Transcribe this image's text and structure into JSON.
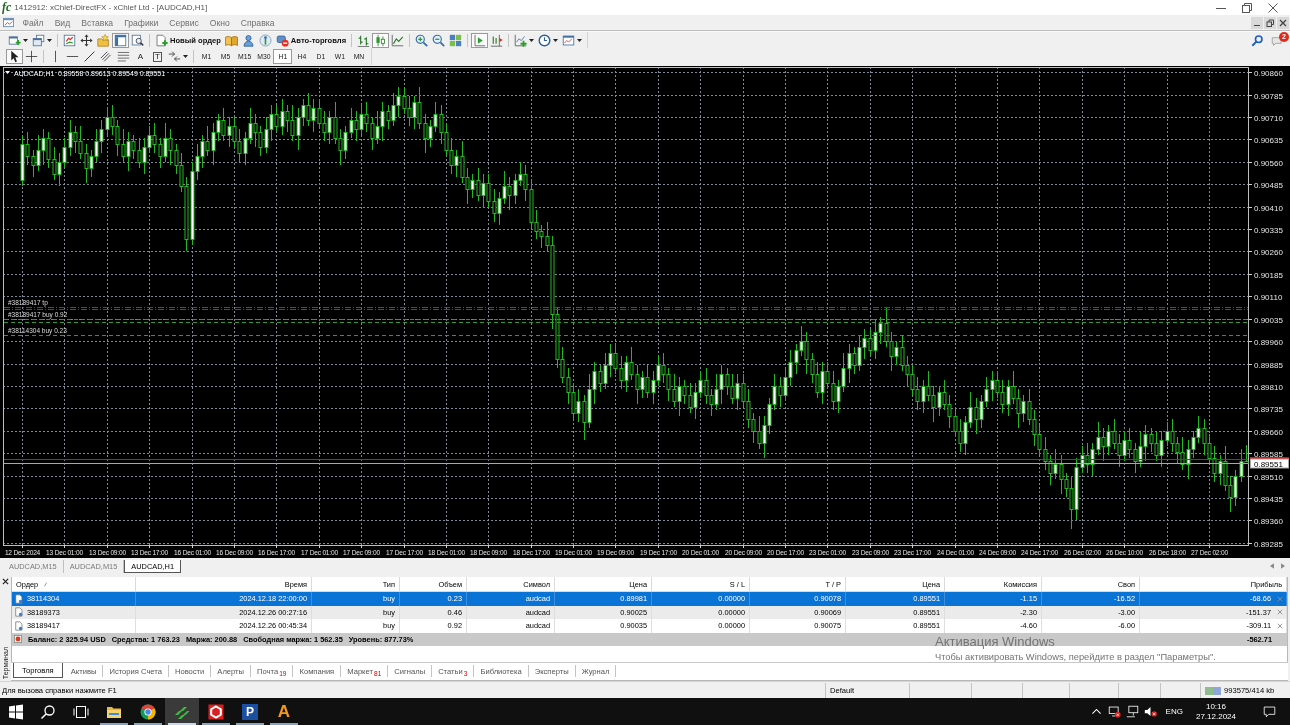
{
  "window": {
    "logo": "fc",
    "title": "1412912: xChief-DirectFX - xChief Ltd - [AUDCAD,H1]"
  },
  "menu": [
    "Файл",
    "Вид",
    "Вставка",
    "Графики",
    "Сервис",
    "Окно",
    "Справка"
  ],
  "toolbar_1": {
    "groups": [
      [
        {
          "kind": "new-chart",
          "pressed": false
        },
        {
          "kind": "profiles",
          "pressed": false
        }
      ],
      [
        {
          "kind": "market-watch",
          "pressed": false
        },
        {
          "kind": "data-window",
          "pressed": false
        },
        {
          "kind": "navigator",
          "pressed": false
        },
        {
          "kind": "terminal",
          "pressed": true
        },
        {
          "kind": "strategy-tester",
          "pressed": false
        }
      ],
      [
        {
          "kind": "new-order",
          "label": "Новый ордер",
          "pressed": false
        },
        {
          "kind": "metaeditor",
          "pressed": false
        },
        {
          "kind": "account",
          "pressed": false
        },
        {
          "kind": "signals",
          "pressed": false
        },
        {
          "kind": "auto-trading",
          "label": "Авто-торговля",
          "pressed": false
        }
      ],
      [
        {
          "kind": "bar-chart",
          "pressed": false
        },
        {
          "kind": "candlesticks",
          "pressed": true
        },
        {
          "kind": "line-chart",
          "pressed": false
        }
      ],
      [
        {
          "kind": "zoom-in",
          "pressed": false
        },
        {
          "kind": "zoom-out",
          "pressed": false
        },
        {
          "kind": "tile",
          "pressed": false
        }
      ],
      [
        {
          "kind": "auto-scroll",
          "pressed": true
        },
        {
          "kind": "chart-shift",
          "pressed": false
        }
      ],
      [
        {
          "kind": "indicators",
          "pressed": false
        },
        {
          "kind": "periods",
          "pressed": false
        },
        {
          "kind": "templates",
          "pressed": false
        }
      ]
    ],
    "messages_badge": "2"
  },
  "toolbar_2": {
    "groups": [
      [
        {
          "kind": "cursor",
          "pressed": true
        },
        {
          "kind": "crosshair",
          "pressed": false
        }
      ],
      [
        {
          "kind": "vertical-line",
          "pressed": false
        },
        {
          "kind": "horizontal-line",
          "pressed": false
        },
        {
          "kind": "trendline",
          "pressed": false
        },
        {
          "kind": "channel",
          "pressed": false
        },
        {
          "kind": "fibonacci",
          "pressed": false
        },
        {
          "kind": "text",
          "glyph": "A",
          "pressed": false
        },
        {
          "kind": "label",
          "glyph": "T",
          "pressed": false
        },
        {
          "kind": "arrows",
          "pressed": false
        }
      ]
    ],
    "timeframes": [
      {
        "label": "M1",
        "selected": false
      },
      {
        "label": "M5",
        "selected": false
      },
      {
        "label": "M15",
        "selected": false
      },
      {
        "label": "M30",
        "selected": false
      },
      {
        "label": "H1",
        "selected": true
      },
      {
        "label": "H4",
        "selected": false
      },
      {
        "label": "D1",
        "selected": false
      },
      {
        "label": "W1",
        "selected": false
      },
      {
        "label": "MN",
        "selected": false
      }
    ]
  },
  "chart": {
    "header": {
      "symbol": "AUDCAD,H1",
      "quote": "0.89558 0.89613 0.89549 0.89551"
    },
    "chart_data": {
      "type": "candlestick",
      "ylim": [
        0.89278,
        0.90877
      ],
      "yticks": [
        {
          "value": 0.9086,
          "label": "0.90860"
        },
        0.90785,
        {
          "value": 0.9071,
          "label": "0.90710"
        },
        0.90635,
        {
          "value": 0.9056,
          "label": "0.90560"
        },
        0.90485,
        {
          "value": 0.9041,
          "label": "0.90410"
        },
        0.90335,
        {
          "value": 0.9026,
          "label": "0.90260"
        },
        0.90185,
        {
          "value": 0.9011,
          "label": "0.90110"
        },
        0.90035,
        {
          "value": 0.8996,
          "label": "0.89960"
        },
        0.89885,
        {
          "value": 0.8981,
          "label": "0.89810"
        },
        0.89735,
        {
          "value": 0.8966,
          "label": "0.89660"
        },
        0.89585,
        {
          "value": 0.8951,
          "label": "0.89510"
        },
        0.89435,
        {
          "value": 0.8936,
          "label": "0.89360"
        },
        0.89285
      ],
      "grid": true,
      "categories": [
        "12 Dec 2024",
        null,
        null,
        null,
        null,
        null,
        null,
        null,
        "13 Dec 01:00",
        null,
        null,
        null,
        null,
        null,
        null,
        null,
        "13 Dec 09:00",
        null,
        null,
        null,
        null,
        null,
        null,
        null,
        "13 Dec 17:00",
        null,
        null,
        null,
        null,
        null,
        null,
        null,
        "16 Dec 01:00",
        null,
        null,
        null,
        null,
        null,
        null,
        null,
        "16 Dec 09:00",
        null,
        null,
        null,
        null,
        null,
        null,
        null,
        "16 Dec 17:00",
        null,
        null,
        null,
        null,
        null,
        null,
        null,
        "17 Dec 01:00",
        null,
        null,
        null,
        null,
        null,
        null,
        null,
        "17 Dec 09:00",
        null,
        null,
        null,
        null,
        null,
        null,
        null,
        "17 Dec 17:00",
        null,
        null,
        null,
        null,
        null,
        null,
        null,
        "18 Dec 01:00",
        null,
        null,
        null,
        null,
        null,
        null,
        null,
        "18 Dec 09:00",
        null,
        null,
        null,
        null,
        null,
        null,
        null,
        "18 Dec 17:00",
        null,
        null,
        null,
        null,
        null,
        null,
        null,
        "19 Dec 01:00",
        null,
        null,
        null,
        null,
        null,
        null,
        null,
        "19 Dec 09:00",
        null,
        null,
        null,
        null,
        null,
        null,
        null,
        "19 Dec 17:00",
        null,
        null,
        null,
        null,
        null,
        null,
        null,
        "20 Dec 01:00",
        null,
        null,
        null,
        null,
        null,
        null,
        null,
        "20 Dec 09:00",
        null,
        null,
        null,
        null,
        null,
        null,
        null,
        "20 Dec 17:00",
        null,
        null,
        null,
        null,
        null,
        null,
        null,
        "23 Dec 01:00",
        null,
        null,
        null,
        null,
        null,
        null,
        null,
        "23 Dec 09:00",
        null,
        null,
        null,
        null,
        null,
        null,
        null,
        "23 Dec 17:00",
        null,
        null,
        null,
        null,
        null,
        null,
        null,
        "24 Dec 01:00",
        null,
        null,
        null,
        null,
        null,
        null,
        null,
        "24 Dec 09:00",
        null,
        null,
        null,
        null,
        null,
        null,
        null,
        "24 Dec 17:00",
        null,
        null,
        null,
        null,
        null,
        null,
        null,
        "26 Dec 02:00",
        null,
        null,
        null,
        null,
        null,
        null,
        null,
        "26 Dec 10:00",
        null,
        null,
        null,
        null,
        null,
        null,
        null,
        "26 Dec 18:00",
        null,
        null,
        null,
        null,
        null,
        null,
        null,
        "27 Dec 02:00",
        null,
        null,
        null,
        null,
        null,
        null,
        null
      ],
      "ohlc": [
        [
          0.905,
          0.9065,
          0.9048,
          0.9062
        ],
        [
          0.9062,
          0.9066,
          0.9055,
          0.9058
        ],
        [
          0.9058,
          0.906,
          0.9051,
          0.9055
        ],
        [
          0.9055,
          0.9065,
          0.9053,
          0.906
        ],
        [
          0.906,
          0.9067,
          0.9055,
          0.9064
        ],
        [
          0.9064,
          0.9066,
          0.9054,
          0.9057
        ],
        [
          0.9057,
          0.9061,
          0.905,
          0.9052
        ],
        [
          0.9052,
          0.9059,
          0.9048,
          0.9056
        ],
        [
          0.9056,
          0.9064,
          0.9054,
          0.9061
        ],
        [
          0.9061,
          0.907,
          0.9058,
          0.9066
        ],
        [
          0.9066,
          0.9068,
          0.9059,
          0.9063
        ],
        [
          0.9063,
          0.9068,
          0.9057,
          0.9059
        ],
        [
          0.9059,
          0.9062,
          0.9049,
          0.9054
        ],
        [
          0.9054,
          0.906,
          0.9051,
          0.9058
        ],
        [
          0.9058,
          0.9067,
          0.9056,
          0.9063
        ],
        [
          0.9063,
          0.907,
          0.9059,
          0.9067
        ],
        [
          0.9067,
          0.9074,
          0.9065,
          0.9071
        ],
        [
          0.9071,
          0.9075,
          0.9065,
          0.9068
        ],
        [
          0.9068,
          0.907,
          0.9058,
          0.9062
        ],
        [
          0.9062,
          0.9067,
          0.9056,
          0.9058
        ],
        [
          0.9058,
          0.9066,
          0.9053,
          0.9063
        ],
        [
          0.9063,
          0.9065,
          0.9057,
          0.906
        ],
        [
          0.906,
          0.9064,
          0.9054,
          0.9056
        ],
        [
          0.9056,
          0.9064,
          0.9052,
          0.9061
        ],
        [
          0.9061,
          0.9068,
          0.9059,
          0.9065
        ],
        [
          0.9065,
          0.9069,
          0.9059,
          0.9062
        ],
        [
          0.9062,
          0.9064,
          0.9054,
          0.9058
        ],
        [
          0.9058,
          0.9069,
          0.9056,
          0.9064
        ],
        [
          0.9064,
          0.9067,
          0.9055,
          0.906
        ],
        [
          0.906,
          0.9062,
          0.9052,
          0.9055
        ],
        [
          0.9055,
          0.9059,
          0.9046,
          0.9048
        ],
        [
          0.9048,
          0.9051,
          0.9026,
          0.903
        ],
        [
          0.903,
          0.9056,
          0.9028,
          0.9053
        ],
        [
          0.9053,
          0.9062,
          0.905,
          0.9058
        ],
        [
          0.9058,
          0.9065,
          0.9054,
          0.9063
        ],
        [
          0.9063,
          0.9068,
          0.9058,
          0.906
        ],
        [
          0.906,
          0.9069,
          0.9055,
          0.9066
        ],
        [
          0.9066,
          0.9072,
          0.9063,
          0.907
        ],
        [
          0.907,
          0.9074,
          0.9063,
          0.9065
        ],
        [
          0.9065,
          0.9071,
          0.9061,
          0.9068
        ],
        [
          0.9068,
          0.9071,
          0.9061,
          0.9063
        ],
        [
          0.9063,
          0.9067,
          0.9056,
          0.9059
        ],
        [
          0.9059,
          0.9066,
          0.9055,
          0.9064
        ],
        [
          0.9064,
          0.9074,
          0.9062,
          0.9069
        ],
        [
          0.9069,
          0.9072,
          0.9061,
          0.9066
        ],
        [
          0.9066,
          0.9068,
          0.9058,
          0.9061
        ],
        [
          0.9061,
          0.9071,
          0.9059,
          0.9067
        ],
        [
          0.9067,
          0.9075,
          0.9063,
          0.9072
        ],
        [
          0.9072,
          0.9075,
          0.9066,
          0.9068
        ],
        [
          0.9068,
          0.9077,
          0.9065,
          0.9073
        ],
        [
          0.9073,
          0.9075,
          0.9066,
          0.907
        ],
        [
          0.907,
          0.9075,
          0.9063,
          0.9065
        ],
        [
          0.9065,
          0.9074,
          0.906,
          0.9071
        ],
        [
          0.9071,
          0.9077,
          0.9068,
          0.9075
        ],
        [
          0.9075,
          0.9079,
          0.9068,
          0.907
        ],
        [
          0.907,
          0.9077,
          0.9066,
          0.9074
        ],
        [
          0.9074,
          0.9077,
          0.9067,
          0.9069
        ],
        [
          0.9069,
          0.9073,
          0.9063,
          0.9066
        ],
        [
          0.9066,
          0.9073,
          0.9062,
          0.9071
        ],
        [
          0.9071,
          0.9076,
          0.9062,
          0.9064
        ],
        [
          0.9064,
          0.9067,
          0.9055,
          0.906
        ],
        [
          0.906,
          0.9068,
          0.9057,
          0.9066
        ],
        [
          0.9066,
          0.9074,
          0.9064,
          0.907
        ],
        [
          0.907,
          0.9073,
          0.9063,
          0.9067
        ],
        [
          0.9067,
          0.9075,
          0.9065,
          0.9072
        ],
        [
          0.9072,
          0.9076,
          0.9066,
          0.9069
        ],
        [
          0.9069,
          0.9071,
          0.906,
          0.9064
        ],
        [
          0.9064,
          0.9073,
          0.9062,
          0.9068
        ],
        [
          0.9068,
          0.9076,
          0.9063,
          0.9073
        ],
        [
          0.9073,
          0.9075,
          0.9067,
          0.907
        ],
        [
          0.907,
          0.9079,
          0.9068,
          0.9075
        ],
        [
          0.9075,
          0.9081,
          0.9071,
          0.9078
        ],
        [
          0.9078,
          0.9081,
          0.9072,
          0.9074
        ],
        [
          0.9074,
          0.9078,
          0.9068,
          0.9071
        ],
        [
          0.9071,
          0.9078,
          0.9067,
          0.9076
        ],
        [
          0.9076,
          0.9081,
          0.9067,
          0.9069
        ],
        [
          0.9069,
          0.9072,
          0.9059,
          0.9064
        ],
        [
          0.9064,
          0.907,
          0.9061,
          0.9068
        ],
        [
          0.9068,
          0.9076,
          0.9066,
          0.9072
        ],
        [
          0.9072,
          0.9075,
          0.9062,
          0.9066
        ],
        [
          0.9066,
          0.9069,
          0.9058,
          0.906
        ],
        [
          0.906,
          0.9064,
          0.9052,
          0.9055
        ],
        [
          0.9055,
          0.906,
          0.9051,
          0.9058
        ],
        [
          0.9058,
          0.9063,
          0.9049,
          0.9051
        ],
        [
          0.9051,
          0.9054,
          0.9042,
          0.9047
        ],
        [
          0.9047,
          0.9052,
          0.9044,
          0.905
        ],
        [
          0.905,
          0.9054,
          0.9043,
          0.9045
        ],
        [
          0.9045,
          0.9052,
          0.9041,
          0.9049
        ],
        [
          0.9049,
          0.9052,
          0.9041,
          0.9043
        ],
        [
          0.9043,
          0.9047,
          0.9036,
          0.9039
        ],
        [
          0.9039,
          0.9046,
          0.9035,
          0.9044
        ],
        [
          0.9044,
          0.9053,
          0.9042,
          0.9048
        ],
        [
          0.9048,
          0.9051,
          0.904,
          0.9045
        ],
        [
          0.9045,
          0.9052,
          0.9042,
          0.905
        ],
        [
          0.905,
          0.9056,
          0.9048,
          0.9052
        ],
        [
          0.9052,
          0.9055,
          0.9043,
          0.9047
        ],
        [
          0.9047,
          0.905,
          0.9034,
          0.9036
        ],
        [
          0.9036,
          0.904,
          0.903,
          0.9033
        ],
        [
          0.9033,
          0.9035,
          0.9027,
          0.9031
        ],
        [
          0.9031,
          0.9036,
          0.9026,
          0.9028
        ],
        [
          0.9028,
          0.9031,
          0.9,
          0.9005
        ],
        [
          0.9005,
          0.9007,
          0.8987,
          0.899
        ],
        [
          0.899,
          0.8994,
          0.8982,
          0.8984
        ],
        [
          0.8984,
          0.8987,
          0.8975,
          0.8979
        ],
        [
          0.8979,
          0.8982,
          0.897,
          0.8972
        ],
        [
          0.8972,
          0.898,
          0.8969,
          0.8976
        ],
        [
          0.8976,
          0.8978,
          0.8963,
          0.8969
        ],
        [
          0.8969,
          0.8985,
          0.8967,
          0.898
        ],
        [
          0.898,
          0.8989,
          0.8975,
          0.8986
        ],
        [
          0.8986,
          0.8988,
          0.8979,
          0.8982
        ],
        [
          0.8982,
          0.8992,
          0.898,
          0.8988
        ],
        [
          0.8988,
          0.8995,
          0.8984,
          0.8992
        ],
        [
          0.8992,
          0.8995,
          0.8985,
          0.8987
        ],
        [
          0.8987,
          0.8991,
          0.898,
          0.8983
        ],
        [
          0.8983,
          0.8991,
          0.8979,
          0.8989
        ],
        [
          0.8989,
          0.8994,
          0.8983,
          0.8985
        ],
        [
          0.8985,
          0.8988,
          0.8975,
          0.898
        ],
        [
          0.898,
          0.8986,
          0.8977,
          0.8984
        ],
        [
          0.8984,
          0.8988,
          0.8977,
          0.8979
        ],
        [
          0.8979,
          0.8986,
          0.8975,
          0.8983
        ],
        [
          0.8983,
          0.8991,
          0.8981,
          0.8988
        ],
        [
          0.8988,
          0.8992,
          0.8982,
          0.8985
        ],
        [
          0.8985,
          0.8987,
          0.8976,
          0.898
        ],
        [
          0.898,
          0.8985,
          0.8974,
          0.8976
        ],
        [
          0.8976,
          0.8984,
          0.8971,
          0.8981
        ],
        [
          0.8981,
          0.8983,
          0.8975,
          0.8978
        ],
        [
          0.8978,
          0.8982,
          0.8972,
          0.8974
        ],
        [
          0.8974,
          0.8982,
          0.897,
          0.8979
        ],
        [
          0.8979,
          0.8986,
          0.8977,
          0.8983
        ],
        [
          0.8983,
          0.8987,
          0.8975,
          0.8978
        ],
        [
          0.8978,
          0.898,
          0.8971,
          0.8975
        ],
        [
          0.8975,
          0.8985,
          0.8973,
          0.898
        ],
        [
          0.898,
          0.8988,
          0.8975,
          0.8985
        ],
        [
          0.8985,
          0.8987,
          0.8978,
          0.8981
        ],
        [
          0.8981,
          0.8985,
          0.8975,
          0.8977
        ],
        [
          0.8977,
          0.8985,
          0.8973,
          0.8982
        ],
        [
          0.8982,
          0.8985,
          0.8974,
          0.8976
        ],
        [
          0.8976,
          0.898,
          0.8967,
          0.897
        ],
        [
          0.897,
          0.8972,
          0.8962,
          0.8966
        ],
        [
          0.8966,
          0.8971,
          0.896,
          0.8962
        ],
        [
          0.8962,
          0.8971,
          0.8957,
          0.8968
        ],
        [
          0.8968,
          0.8977,
          0.8965,
          0.8975
        ],
        [
          0.8975,
          0.8985,
          0.8973,
          0.8981
        ],
        [
          0.8981,
          0.8984,
          0.8974,
          0.8978
        ],
        [
          0.8978,
          0.8987,
          0.8976,
          0.8984
        ],
        [
          0.8984,
          0.8993,
          0.8981,
          0.8989
        ],
        [
          0.8989,
          0.8995,
          0.8985,
          0.8993
        ],
        [
          0.8993,
          0.9001,
          0.8991,
          0.8996
        ],
        [
          0.8996,
          0.8999,
          0.8985,
          0.899
        ],
        [
          0.899,
          0.8992,
          0.8982,
          0.8985
        ],
        [
          0.8985,
          0.8989,
          0.8977,
          0.8979
        ],
        [
          0.8979,
          0.8989,
          0.8975,
          0.8986
        ],
        [
          0.8986,
          0.8989,
          0.898,
          0.8982
        ],
        [
          0.8982,
          0.8986,
          0.8973,
          0.8976
        ],
        [
          0.8976,
          0.8983,
          0.8972,
          0.8981
        ],
        [
          0.8981,
          0.8992,
          0.8979,
          0.8987
        ],
        [
          0.8987,
          0.8995,
          0.8982,
          0.8992
        ],
        [
          0.8992,
          0.8994,
          0.8985,
          0.8988
        ],
        [
          0.8988,
          0.8998,
          0.8986,
          0.8994
        ],
        [
          0.8994,
          0.9,
          0.899,
          0.8997
        ],
        [
          0.8997,
          0.9,
          0.8991,
          0.8993
        ],
        [
          0.8993,
          0.9003,
          0.899,
          0.8999
        ],
        [
          0.8999,
          0.9004,
          0.8995,
          0.9002
        ],
        [
          0.9002,
          0.9007,
          0.8994,
          0.8996
        ],
        [
          0.8996,
          0.8999,
          0.8986,
          0.8991
        ],
        [
          0.8991,
          0.8996,
          0.8988,
          0.8994
        ],
        [
          0.8994,
          0.8998,
          0.8986,
          0.8988
        ],
        [
          0.8988,
          0.8991,
          0.8981,
          0.8985
        ],
        [
          0.8985,
          0.8988,
          0.8978,
          0.898
        ],
        [
          0.898,
          0.8984,
          0.8973,
          0.8976
        ],
        [
          0.8976,
          0.8983,
          0.8972,
          0.8981
        ],
        [
          0.8981,
          0.8986,
          0.8976,
          0.8978
        ],
        [
          0.8978,
          0.8981,
          0.8969,
          0.8974
        ],
        [
          0.8974,
          0.8981,
          0.8971,
          0.8979
        ],
        [
          0.8979,
          0.8983,
          0.8973,
          0.8975
        ],
        [
          0.8975,
          0.8978,
          0.8967,
          0.8971
        ],
        [
          0.8971,
          0.8974,
          0.8964,
          0.8966
        ],
        [
          0.8966,
          0.897,
          0.8959,
          0.8962
        ],
        [
          0.8962,
          0.8971,
          0.8958,
          0.8969
        ],
        [
          0.8969,
          0.8979,
          0.8967,
          0.8974
        ],
        [
          0.8974,
          0.8977,
          0.8965,
          0.897
        ],
        [
          0.897,
          0.8978,
          0.8967,
          0.8976
        ],
        [
          0.8976,
          0.8984,
          0.8974,
          0.898
        ],
        [
          0.898,
          0.8986,
          0.8976,
          0.8983
        ],
        [
          0.8983,
          0.8986,
          0.8977,
          0.8979
        ],
        [
          0.8979,
          0.8983,
          0.8972,
          0.8975
        ],
        [
          0.8975,
          0.8983,
          0.8971,
          0.8981
        ],
        [
          0.8981,
          0.8986,
          0.8975,
          0.8977
        ],
        [
          0.8977,
          0.898,
          0.8967,
          0.8972
        ],
        [
          0.8972,
          0.8978,
          0.8969,
          0.8976
        ],
        [
          0.8976,
          0.898,
          0.8968,
          0.897
        ],
        [
          0.897,
          0.8973,
          0.8961,
          0.8965
        ],
        [
          0.8965,
          0.8968,
          0.8958,
          0.896
        ],
        [
          0.896,
          0.8964,
          0.8953,
          0.8956
        ],
        [
          0.8956,
          0.8958,
          0.8948,
          0.8952
        ],
        [
          0.8952,
          0.896,
          0.895,
          0.8955
        ],
        [
          0.8955,
          0.8958,
          0.8945,
          0.895
        ],
        [
          0.895,
          0.8952,
          0.8944,
          0.8947
        ],
        [
          0.8947,
          0.8951,
          0.8933,
          0.894
        ],
        [
          0.894,
          0.8957,
          0.8936,
          0.8954
        ],
        [
          0.8954,
          0.8961,
          0.8952,
          0.8958
        ],
        [
          0.8958,
          0.8962,
          0.8952,
          0.8955
        ],
        [
          0.8955,
          0.8962,
          0.8951,
          0.896
        ],
        [
          0.896,
          0.8969,
          0.8958,
          0.8964
        ],
        [
          0.8964,
          0.8967,
          0.8956,
          0.8961
        ],
        [
          0.8961,
          0.8968,
          0.8958,
          0.8966
        ],
        [
          0.8966,
          0.897,
          0.896,
          0.8962
        ],
        [
          0.8962,
          0.8965,
          0.8954,
          0.8958
        ],
        [
          0.8958,
          0.8966,
          0.8956,
          0.8963
        ],
        [
          0.8963,
          0.8967,
          0.8957,
          0.896
        ],
        [
          0.896,
          0.8962,
          0.8952,
          0.8956
        ],
        [
          0.8956,
          0.8966,
          0.8954,
          0.8961
        ],
        [
          0.8961,
          0.8968,
          0.8956,
          0.8965
        ],
        [
          0.8965,
          0.8967,
          0.8959,
          0.8962
        ],
        [
          0.8962,
          0.8966,
          0.8956,
          0.8958
        ],
        [
          0.8958,
          0.8966,
          0.8954,
          0.8963
        ],
        [
          0.8963,
          0.8969,
          0.8961,
          0.8966
        ],
        [
          0.8966,
          0.897,
          0.8959,
          0.8962
        ],
        [
          0.8962,
          0.8964,
          0.8955,
          0.8959
        ],
        [
          0.8959,
          0.8964,
          0.8953,
          0.8955
        ],
        [
          0.8955,
          0.8963,
          0.895,
          0.896
        ],
        [
          0.896,
          0.8966,
          0.8957,
          0.8964
        ],
        [
          0.8964,
          0.8971,
          0.8962,
          0.8967
        ],
        [
          0.8967,
          0.897,
          0.8958,
          0.8962
        ],
        [
          0.8962,
          0.8965,
          0.8955,
          0.8957
        ],
        [
          0.8957,
          0.8961,
          0.8949,
          0.8952
        ],
        [
          0.8952,
          0.8958,
          0.8948,
          0.8956
        ],
        [
          0.8956,
          0.8961,
          0.8946,
          0.8948
        ],
        [
          0.8948,
          0.8951,
          0.8939,
          0.8944
        ],
        [
          0.8944,
          0.8953,
          0.8941,
          0.8951
        ],
        [
          0.8951,
          0.896,
          0.8949,
          0.8956
        ],
        [
          0.89558,
          0.89613,
          0.89549,
          0.89551
        ]
      ],
      "ref_lines": [
        {
          "axis": "y",
          "value": 0.90075,
          "label": "#38189417 tp",
          "color": "#ff0000",
          "line_style": "dashdot"
        },
        {
          "axis": "y",
          "value": 0.90069,
          "color": "#ff0000",
          "line_style": "dashdot"
        },
        {
          "axis": "y",
          "value": 0.90035,
          "label": "#38189417 buy 0.92",
          "color": "#2f9a2f",
          "line_style": "dashed"
        },
        {
          "axis": "y",
          "value": 0.90025,
          "color": "#2f9a2f",
          "line_style": "dashed"
        },
        {
          "axis": "y",
          "value": 0.89981,
          "label": "#38114304 buy 0.23",
          "color": "#2f9a2f",
          "line_style": "dashed"
        },
        {
          "axis": "y",
          "value": 0.89567,
          "color": "#ff0000",
          "line_style": "solid"
        },
        {
          "axis": "y",
          "value": 0.89551,
          "label": "0.89551",
          "color": "#a8a8a8",
          "line_style": "solid"
        }
      ]
    }
  },
  "chart_tabs": [
    {
      "label": "AUDCAD,M15",
      "selected": false
    },
    {
      "label": "AUDCAD,M15",
      "selected": false
    },
    {
      "label": "AUDCAD,H1",
      "selected": true
    }
  ],
  "terminal": {
    "title": "Терминал",
    "columns": [
      {
        "label": "Ордер",
        "sorted": true
      },
      {
        "label": "Время",
        "sorted": false
      },
      {
        "label": "Тип",
        "sorted": false
      },
      {
        "label": "Объем",
        "sorted": false
      },
      {
        "label": "Символ",
        "sorted": false
      },
      {
        "label": "Цена",
        "sorted": false
      },
      {
        "label": "S / L",
        "sorted": false
      },
      {
        "label": "T / P",
        "sorted": false
      },
      {
        "label": "Цена",
        "sorted": false
      },
      {
        "label": "Комиссия",
        "sorted": false
      },
      {
        "label": "Своп",
        "sorted": false
      },
      {
        "label": "Прибыль",
        "sorted": false
      }
    ],
    "rows": [
      {
        "cells": [
          "38114304",
          "2024.12.18 22:00:00",
          "buy",
          "0.23",
          "audcad",
          "0.89981",
          "0.00000",
          "0.90078",
          "0.89551",
          "-1.15",
          "-16.52",
          "-68.66"
        ],
        "selected": true
      },
      {
        "cells": [
          "38189373",
          "2024.12.26 00:27:16",
          "buy",
          "0.46",
          "audcad",
          "0.90025",
          "0.00000",
          "0.90069",
          "0.89551",
          "-2.30",
          "-3.00",
          "-151.37"
        ],
        "selected": false
      },
      {
        "cells": [
          "38189417",
          "2024.12.26 00:45:34",
          "buy",
          "0.92",
          "audcad",
          "0.90035",
          "0.00000",
          "0.90075",
          "0.89551",
          "-4.60",
          "-6.00",
          "-309.11"
        ],
        "selected": false
      }
    ],
    "summary": {
      "fields": [
        "Баланс: 2 325.94 USD",
        "Средства: 1 763.23",
        "Маржа: 200.88",
        "Свободная маржа: 1 562.35",
        "Уровень: 877.73%"
      ],
      "total": "-562.71"
    },
    "tabs": [
      {
        "label": "Торговля",
        "selected": true
      },
      {
        "label": "Активы",
        "selected": false
      },
      {
        "label": "История Счета",
        "selected": false
      },
      {
        "label": "Новости",
        "selected": false
      },
      {
        "label": "Алерты",
        "selected": false
      },
      {
        "label": "Почта",
        "badge": "19",
        "selected": false
      },
      {
        "label": "Компания",
        "selected": false
      },
      {
        "label": "Маркет",
        "badge": "81",
        "selected": false
      },
      {
        "label": "Сигналы",
        "selected": false
      },
      {
        "label": "Статьи",
        "badge": "3",
        "selected": false
      },
      {
        "label": "Библиотека",
        "selected": false
      },
      {
        "label": "Эксперты",
        "selected": false
      },
      {
        "label": "Журнал",
        "selected": false
      }
    ]
  },
  "os_notice": {
    "title": "Активация Windows",
    "text": "Чтобы активировать Windows, перейдите в раздел \"Параметры\"."
  },
  "status_bar": {
    "help": "Для вызова справки нажмите F1",
    "profile": "Default",
    "traffic": "993575/414 kb"
  },
  "taskbar": {
    "apps": [
      {
        "kind": "folder",
        "running": true,
        "active": false
      },
      {
        "kind": "browser",
        "running": true,
        "active": false
      },
      {
        "kind": "trading",
        "running": true,
        "active": true
      },
      {
        "kind": "hexagon",
        "running": true,
        "active": false
      },
      {
        "kind": "tile",
        "glyph": "P",
        "running": true,
        "active": false
      },
      {
        "kind": "letter",
        "glyph": "A",
        "running": true,
        "active": false
      }
    ],
    "sound_muted": true,
    "language": "ENG",
    "time": "10:16",
    "date": "27.12.2024"
  }
}
